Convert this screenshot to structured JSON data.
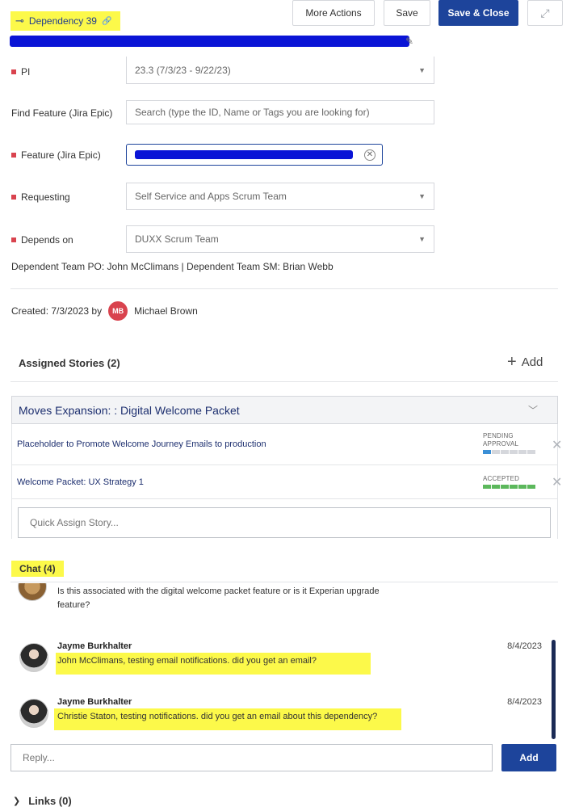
{
  "header": {
    "dependency_label": "Dependency 39",
    "link_glyph": "🔗",
    "connector_glyph": "⊸",
    "more_actions": "More Actions",
    "save": "Save",
    "save_close": "Save & Close",
    "expand_glyph": "⤢",
    "edit_glyph": "✎"
  },
  "form": {
    "pi": {
      "label": "PI",
      "value": "23.3 (7/3/23 - 9/22/23)"
    },
    "find_feature": {
      "label": "Find Feature (Jira Epic)",
      "placeholder": "Search (type the ID, Name or Tags you are looking for)"
    },
    "feature": {
      "label": "Feature (Jira Epic)"
    },
    "requesting": {
      "label": "Requesting",
      "value": "Self Service and Apps Scrum Team"
    },
    "depends_on": {
      "label": "Depends on",
      "value": "DUXX Scrum Team"
    },
    "team_info": "Dependent Team PO: John McClimans | Dependent Team SM: Brian Webb",
    "caret": "▼"
  },
  "created": {
    "text": "Created: 7/3/2023 by",
    "initials": "MB",
    "name": "Michael Brown"
  },
  "stories": {
    "title": "Assigned Stories (2)",
    "add_label": "Add",
    "plus": "+",
    "epic": "Moves Expansion: : Digital Welcome Packet",
    "chevron": "﹀",
    "items": [
      {
        "title": "Placeholder to Promote Welcome Journey Emails to production",
        "status_line1": "PENDING",
        "status_line2": "APPROVAL",
        "progress": 0.2,
        "progress_color": "#3a8fd6"
      },
      {
        "title": "Welcome Packet: UX Strategy 1",
        "status_line1": "ACCEPTED",
        "status_line2": "",
        "progress": 1.0,
        "progress_color": "#5cb85c"
      }
    ],
    "remove_glyph": "✕",
    "quick_assign_placeholder": "Quick Assign Story..."
  },
  "chat": {
    "title": "Chat (4)",
    "partial_message": "Is this associated with the digital welcome packet feature or is it Experian upgrade feature?",
    "messages": [
      {
        "author": "Jayme Burkhalter",
        "date": "8/4/2023",
        "text": "John McClimans, testing email notifications. did you get an email?"
      },
      {
        "author": "Jayme Burkhalter",
        "date": "8/4/2023",
        "text": "Christie Staton, testing notifications. did you get an email about this dependency?"
      }
    ],
    "reply_placeholder": "Reply...",
    "add_button": "Add"
  },
  "links": {
    "chevron": "❯",
    "label": "Links (0)"
  },
  "colors": {
    "primary": "#1d449b",
    "required": "#d9434e",
    "highlight": "#fcf94a",
    "redaction": "#0a14d6"
  }
}
